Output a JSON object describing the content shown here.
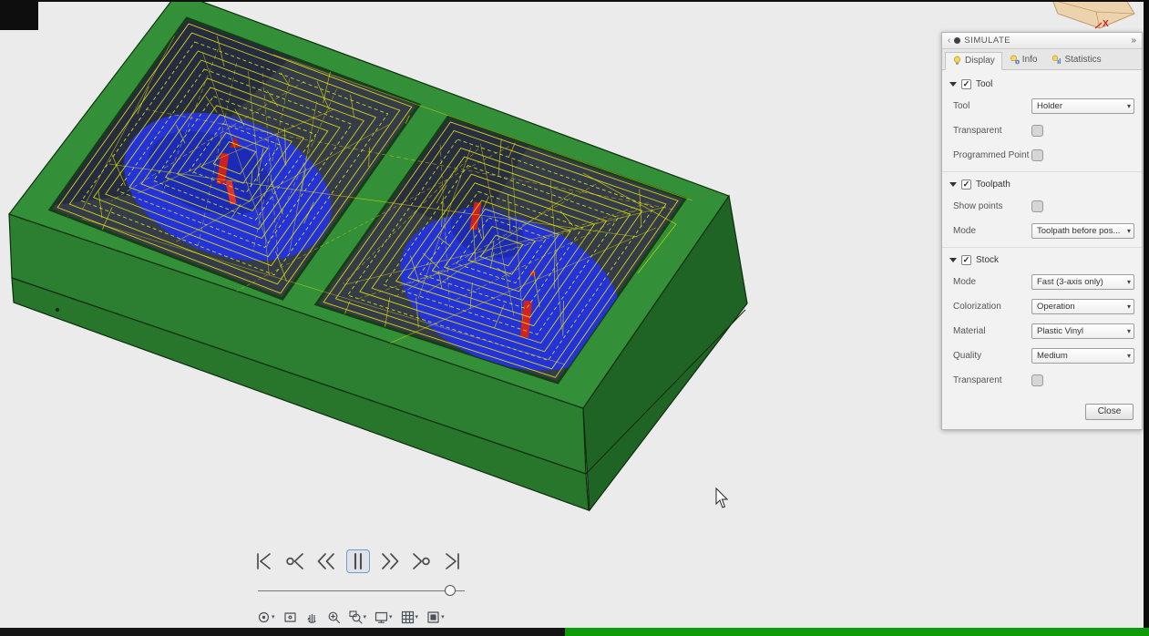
{
  "viewport": {
    "background": "#ebebeb",
    "stock_color": "#2f8a33",
    "toolpath_color": "#e8e400",
    "machined_color": "#2433d9",
    "collision_color": "#d22020",
    "axis_label_x": "X"
  },
  "panel": {
    "title": "SIMULATE",
    "collapse_icon": "‹",
    "expand_icon": "»",
    "active_tab": "Display",
    "tabs": [
      {
        "label": "Display"
      },
      {
        "label": "Info"
      },
      {
        "label": "Statistics"
      }
    ],
    "sections": [
      {
        "title": "Tool",
        "checked": true,
        "rows": [
          {
            "label": "Tool",
            "value": "Holder"
          },
          {
            "label": "Transparent",
            "checked": false
          },
          {
            "label": "Programmed Point",
            "checked": false
          }
        ]
      },
      {
        "title": "Toolpath",
        "checked": true,
        "rows": [
          {
            "label": "Show points",
            "checked": false
          },
          {
            "label": "Mode",
            "value": "Toolpath before pos..."
          }
        ]
      },
      {
        "title": "Stock",
        "checked": true,
        "rows": [
          {
            "label": "Mode",
            "value": "Fast (3-axis only)"
          },
          {
            "label": "Colorization",
            "value": "Operation"
          },
          {
            "label": "Material",
            "value": "Plastic Vinyl"
          },
          {
            "label": "Quality",
            "value": "Medium"
          },
          {
            "label": "Transparent",
            "checked": false
          }
        ]
      }
    ],
    "close_label": "Close"
  },
  "playback": {
    "buttons": [
      "skip-to-start",
      "previous-operation",
      "step-back",
      "pause",
      "step-forward",
      "next-operation",
      "skip-to-end"
    ],
    "active_button": "pause",
    "slider_position": 0.93
  },
  "navbar": {
    "items": [
      {
        "name": "orbit",
        "has_dropdown": true
      },
      {
        "name": "look-at",
        "has_dropdown": false
      },
      {
        "name": "pan",
        "has_dropdown": false
      },
      {
        "name": "zoom",
        "has_dropdown": false
      },
      {
        "name": "zoom-window",
        "has_dropdown": true
      },
      {
        "name": "display-settings",
        "has_dropdown": true
      },
      {
        "name": "grid-settings",
        "has_dropdown": true
      },
      {
        "name": "viewports",
        "has_dropdown": true
      }
    ]
  },
  "statusbar": {
    "left_color": "#141414",
    "progress_color": "#0b9b0b"
  }
}
